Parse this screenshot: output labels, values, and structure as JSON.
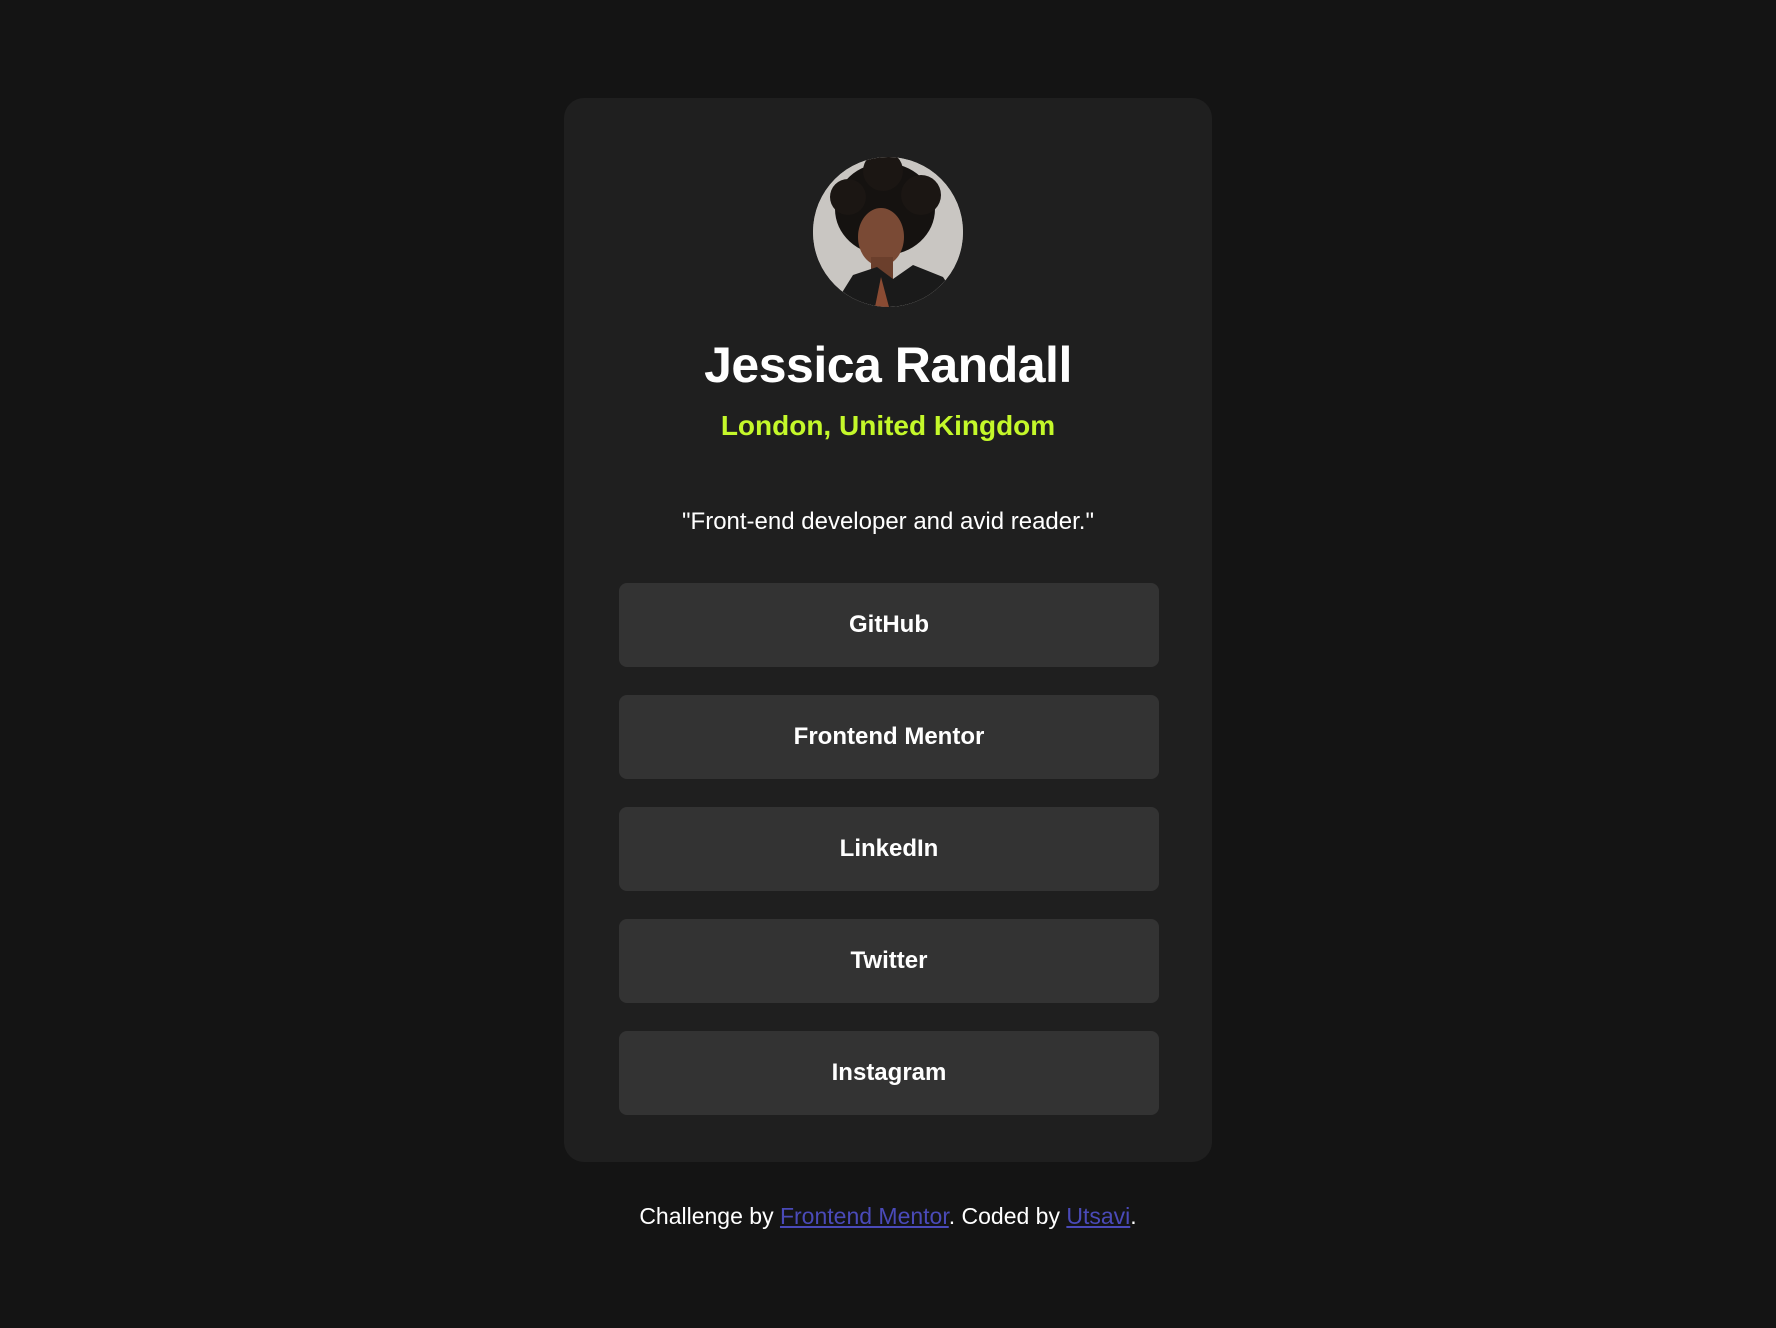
{
  "profile": {
    "name": "Jessica Randall",
    "location": "London, United Kingdom",
    "bio": "\"Front-end developer and avid reader.\""
  },
  "links": [
    {
      "label": "GitHub"
    },
    {
      "label": "Frontend Mentor"
    },
    {
      "label": "LinkedIn"
    },
    {
      "label": "Twitter"
    },
    {
      "label": "Instagram"
    }
  ],
  "footer": {
    "prefix": "Challenge by ",
    "challenge_link": "Frontend Mentor",
    "middle": ". Coded by ",
    "author_link": "Utsavi",
    "suffix": "."
  },
  "colors": {
    "page_background": "#141414",
    "card_background": "#1f1f1f",
    "button_background": "#333333",
    "accent": "#c4f82a",
    "footer_link": "#4a4ab8"
  }
}
